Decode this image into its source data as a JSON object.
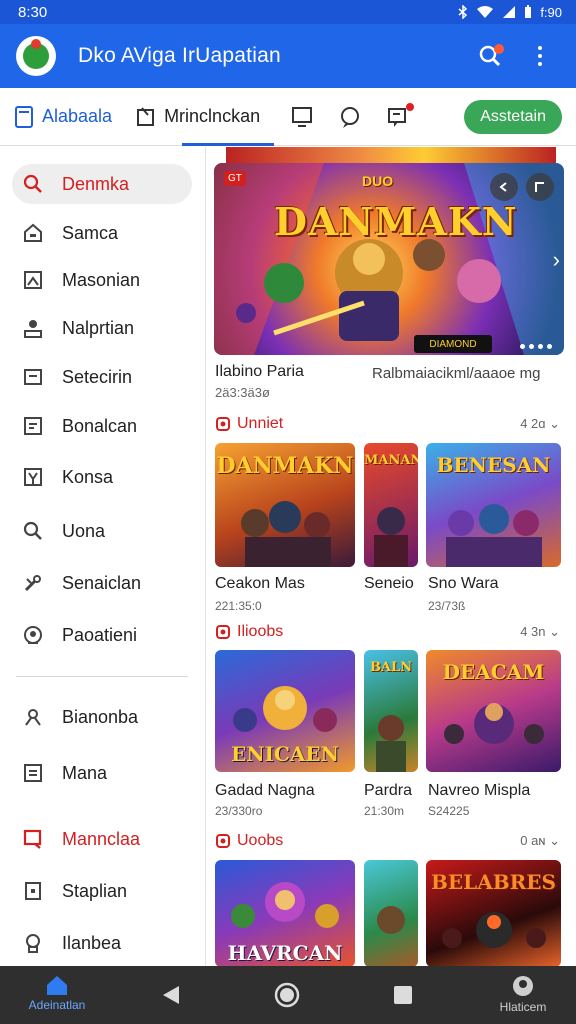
{
  "status": {
    "time": "8:30",
    "right": "f:90"
  },
  "app": {
    "title": "Dko AVigа IrUapatian"
  },
  "tabs": {
    "first": "Alabaala",
    "second": "Mrinclnckan",
    "cta": "Asstetain"
  },
  "sidebar": {
    "items": [
      {
        "label": "Denmkа",
        "icon": "search-icon"
      },
      {
        "label": "Samca",
        "icon": "home-icon"
      },
      {
        "label": "Masonian",
        "icon": "grid-icon"
      },
      {
        "label": "Nalprtian",
        "icon": "person-icon"
      },
      {
        "label": "Setecirin",
        "icon": "window-icon"
      },
      {
        "label": "Bonalcan",
        "icon": "list-icon"
      },
      {
        "label": "Konsa",
        "icon": "controller-icon"
      },
      {
        "label": "Uona",
        "icon": "search-icon"
      },
      {
        "label": "Senaiclan",
        "icon": "tools-icon"
      },
      {
        "label": "Paoatieni",
        "icon": "circle-icon"
      },
      {
        "label": "Bianonba",
        "icon": "person-icon"
      },
      {
        "label": "Mana",
        "icon": "doc-icon"
      },
      {
        "label": "Mannclaa",
        "icon": "message-icon"
      },
      {
        "label": "Staplian",
        "icon": "box-icon"
      },
      {
        "label": "Ilanbea",
        "icon": "bell-icon"
      }
    ]
  },
  "hero": {
    "badge": "GT",
    "art_title": "DANMAKN",
    "art_tag": "DUO",
    "cta": "DIAMOND",
    "caption_left": "Ilabino Paria",
    "caption_right": "Ralbmaiacikml/aaaoe mg",
    "sub": "2ä3:3ä3ø"
  },
  "sections": [
    {
      "title": "Unniet",
      "more": "4 2ɑ ⌄",
      "tiles": [
        {
          "art": "DANMAKN",
          "name": "Ceakon Mas",
          "sub": "221:35:0"
        },
        {
          "art": "MANAN",
          "name": "Seneio",
          "sub": ""
        },
        {
          "art": "BENESAN",
          "name": "Sno Wara",
          "sub": "23/73ß"
        }
      ]
    },
    {
      "title": "Ilioobs",
      "more": "4 3n ⌄",
      "tiles": [
        {
          "art": "ENICAEN",
          "name": "Gadad Nagna",
          "sub": "23/330ro"
        },
        {
          "art": "BALN",
          "name": "Pardra",
          "sub": "21:30m"
        },
        {
          "art": "DEACAM",
          "name": "Navreo Mispla",
          "sub": "S24225"
        }
      ]
    },
    {
      "title": "Uoobs",
      "more": "0 aɴ ⌄",
      "tiles": [
        {
          "art": "HAVRCAN",
          "name": "",
          "sub": ""
        },
        {
          "art": "",
          "name": "",
          "sub": ""
        },
        {
          "art": "BELABRES",
          "name": "",
          "sub": ""
        }
      ]
    }
  ],
  "nav": {
    "home": "Adeinatlan",
    "right": "Hlaticem"
  },
  "colors": {
    "appbar": "#1f66e8",
    "accent_red": "#d32020",
    "cta_green": "#3aa657"
  }
}
